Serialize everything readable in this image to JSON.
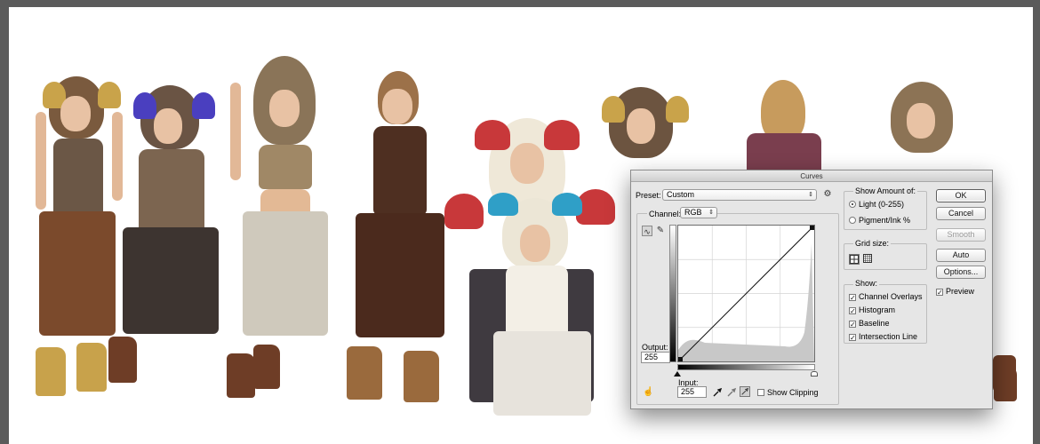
{
  "dialog": {
    "title": "Curves",
    "preset_label": "Preset:",
    "preset_value": "Custom",
    "channel_label": "Channel:",
    "channel_value": "RGB",
    "output_label": "Output:",
    "output_value": "255",
    "input_label": "Input:",
    "input_value": "255",
    "show_clipping_label": "Show Clipping",
    "show_amount": {
      "heading": "Show Amount of:",
      "options": [
        {
          "label": "Light  (0-255)",
          "selected": true
        },
        {
          "label": "Pigment/Ink %",
          "selected": false
        }
      ]
    },
    "grid_size_heading": "Grid size:",
    "show": {
      "heading": "Show:",
      "options": [
        {
          "label": "Channel Overlays",
          "checked": true
        },
        {
          "label": "Histogram",
          "checked": true
        },
        {
          "label": "Baseline",
          "checked": true
        },
        {
          "label": "Intersection Line",
          "checked": true
        }
      ]
    },
    "buttons": {
      "ok": "OK",
      "cancel": "Cancel",
      "smooth": "Smooth",
      "auto": "Auto",
      "options": "Options..."
    },
    "preview_label": "Preview",
    "preview_checked": true,
    "curve": {
      "points": [
        [
          0,
          0
        ],
        [
          255,
          255
        ]
      ]
    }
  },
  "icons": {
    "curve_tool": "curve-icon",
    "pencil_tool": "pencil-icon",
    "preset_options": "gear-icon",
    "black_eyedropper": "eyedropper-black-icon",
    "gray_eyedropper": "eyedropper-gray-icon",
    "white_eyedropper": "eyedropper-white-icon",
    "hand_tool": "target-adjust-icon",
    "grid_simple": "grid-4-icon",
    "grid_detailed": "grid-10-icon"
  },
  "colors": {
    "dialog_bg": "#e6e6e6",
    "canvas_bg": "#ffffff",
    "workspace_bg": "#5b5b5b"
  }
}
